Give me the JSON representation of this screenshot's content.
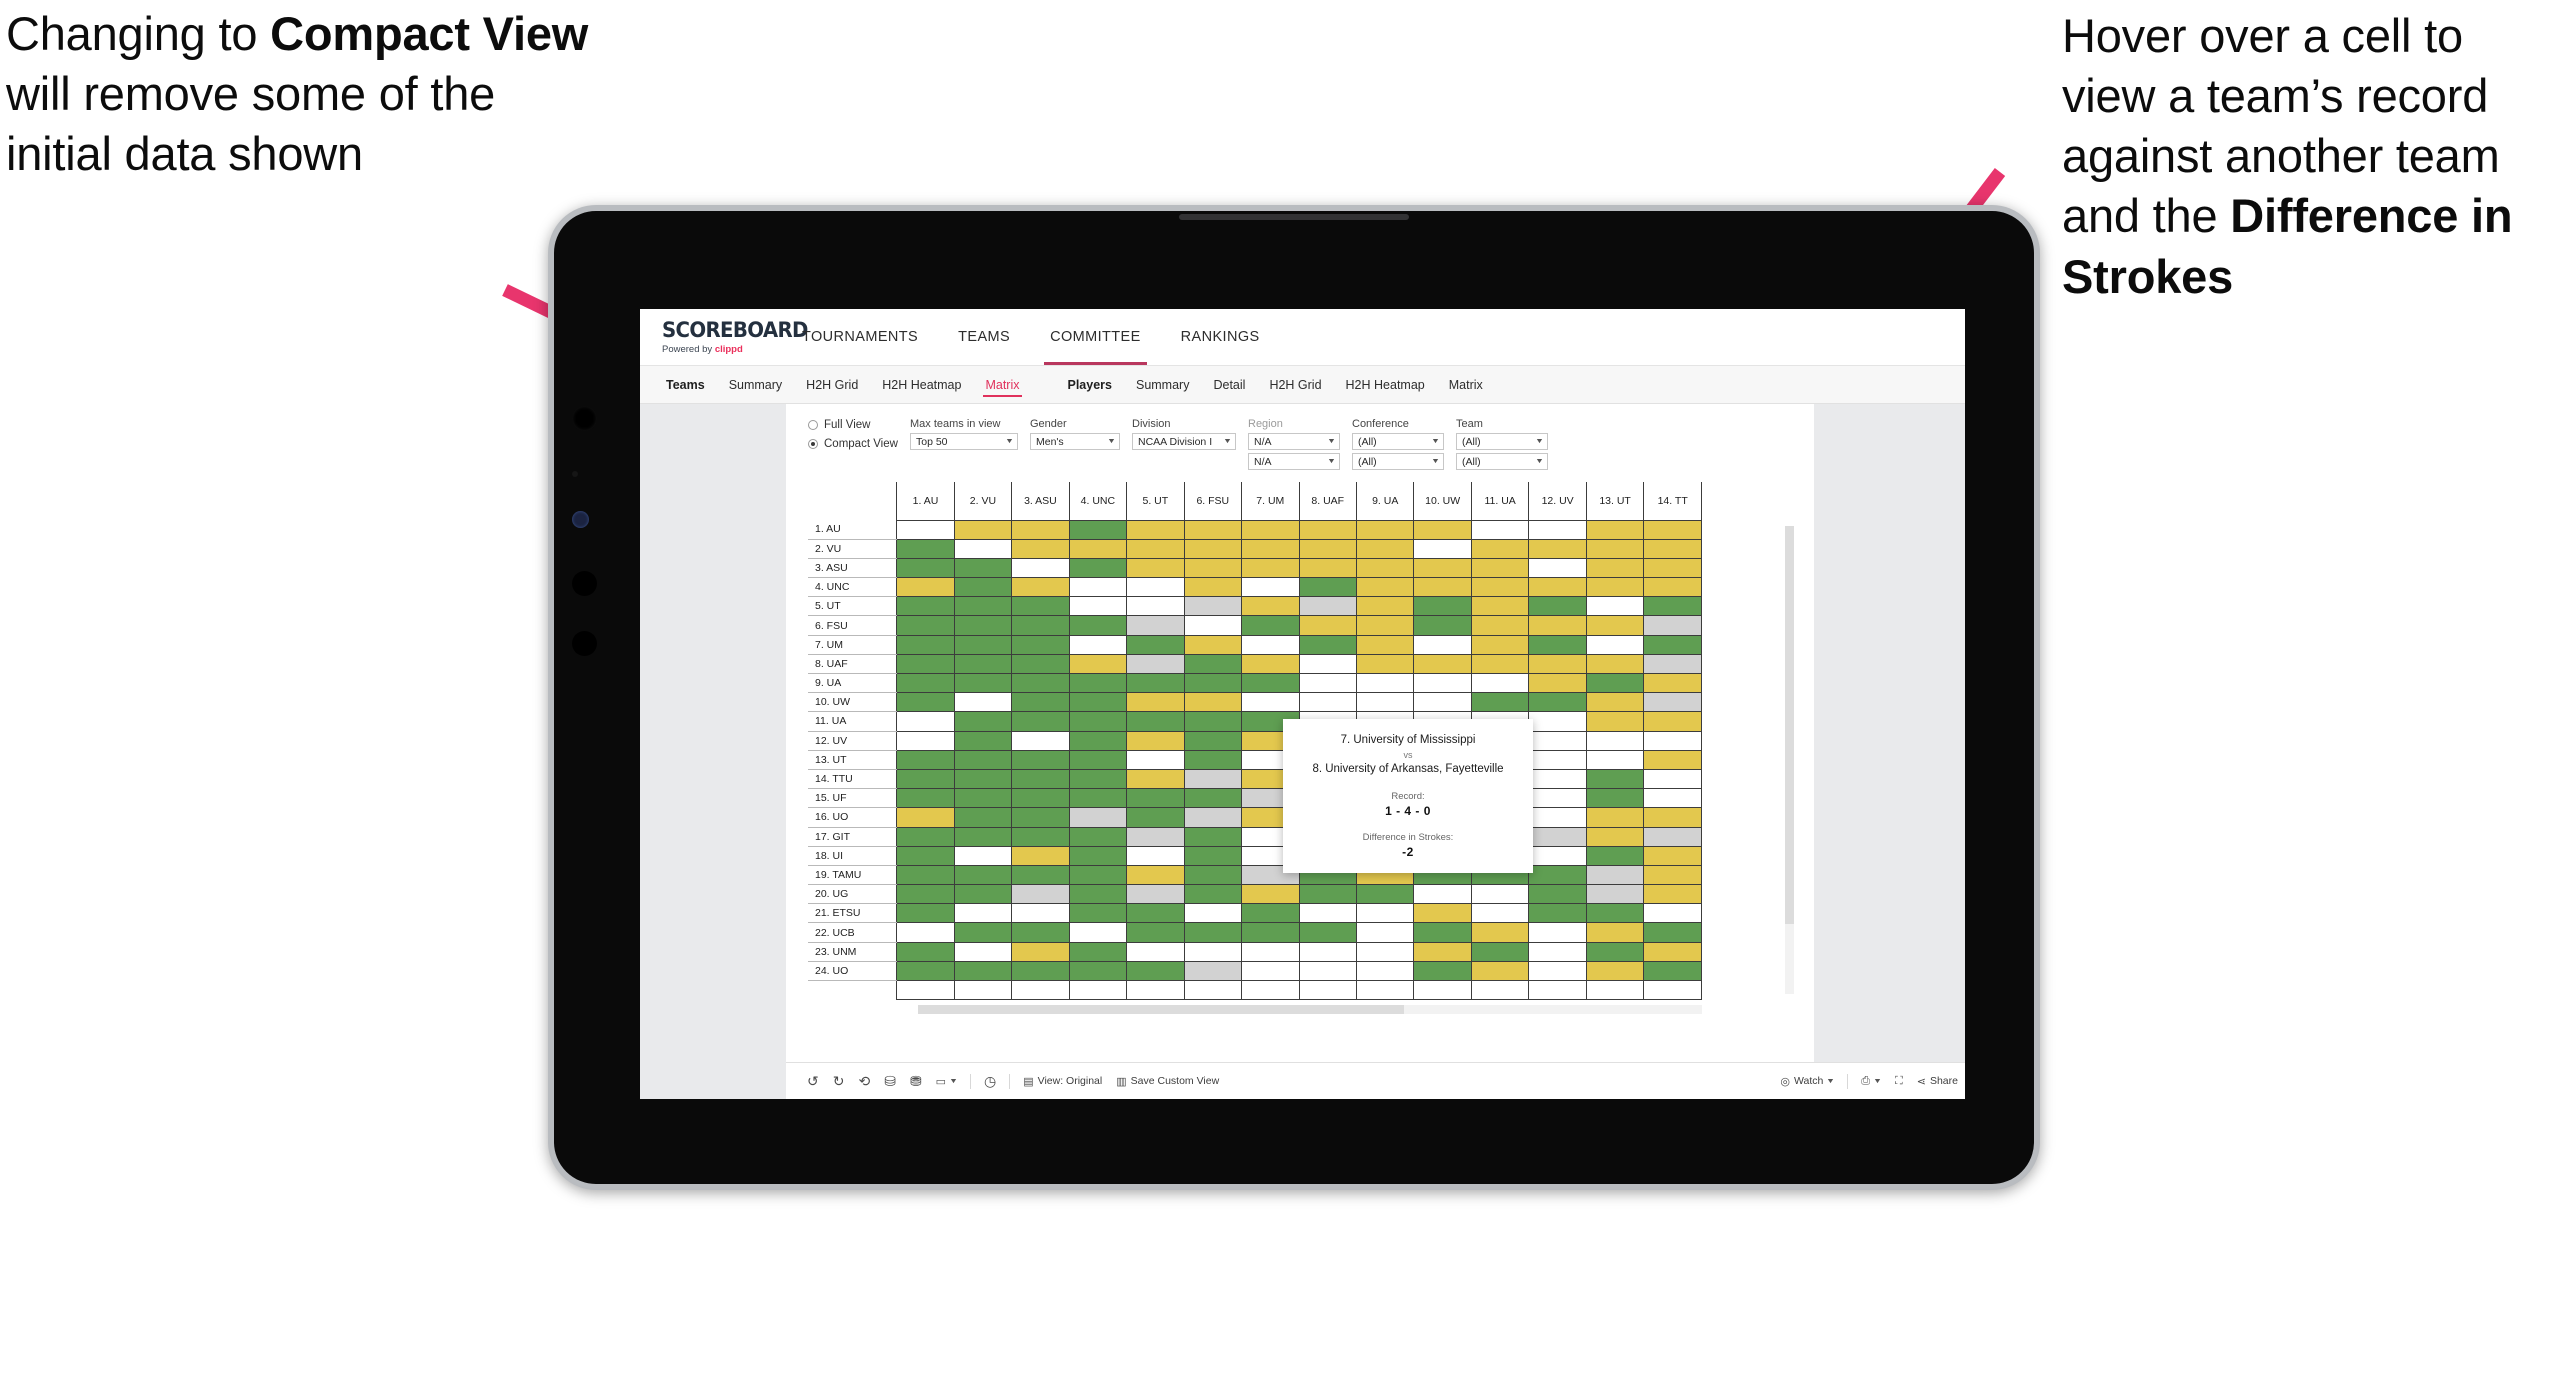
{
  "annotations": {
    "left": {
      "pre": "Changing to ",
      "bold": "Compact View",
      "post": " will remove some of the initial data shown"
    },
    "right": {
      "pre": "Hover over a cell to view a team’s record against another team and the ",
      "bold": "Difference in Strokes",
      "post": ""
    },
    "arrow_color": "#e8356d"
  },
  "app": {
    "brand": {
      "logo": "SCOREBOARD",
      "powered_prefix": "Powered by ",
      "powered_name": "clippd"
    },
    "topnav": [
      {
        "label": "TOURNAMENTS",
        "active": false
      },
      {
        "label": "TEAMS",
        "active": false
      },
      {
        "label": "COMMITTEE",
        "active": true
      },
      {
        "label": "RANKINGS",
        "active": false
      }
    ],
    "subnav": {
      "group1_title": "Teams",
      "group1": [
        {
          "label": "Summary",
          "active": false
        },
        {
          "label": "H2H Grid",
          "active": false
        },
        {
          "label": "H2H Heatmap",
          "active": false
        },
        {
          "label": "Matrix",
          "active": true
        }
      ],
      "group2_title": "Players",
      "group2": [
        {
          "label": "Summary",
          "active": false
        },
        {
          "label": "Detail",
          "active": false
        },
        {
          "label": "H2H Grid",
          "active": false
        },
        {
          "label": "H2H Heatmap",
          "active": false
        },
        {
          "label": "Matrix",
          "active": false
        }
      ]
    },
    "filters": {
      "view_modes": [
        {
          "label": "Full View",
          "selected": false
        },
        {
          "label": "Compact View",
          "selected": true
        }
      ],
      "fields": [
        {
          "label": "Max teams in view",
          "muted": false,
          "values": [
            "Top 50"
          ],
          "width": "w-teams"
        },
        {
          "label": "Gender",
          "muted": false,
          "values": [
            "Men's"
          ],
          "width": "w-gender"
        },
        {
          "label": "Division",
          "muted": false,
          "values": [
            "NCAA Division I"
          ],
          "width": "w-div"
        },
        {
          "label": "Region",
          "muted": true,
          "values": [
            "N/A",
            "N/A"
          ],
          "width": "w-reg"
        },
        {
          "label": "Conference",
          "muted": false,
          "values": [
            "(All)",
            "(All)"
          ],
          "width": "w-conf"
        },
        {
          "label": "Team",
          "muted": false,
          "values": [
            "(All)",
            "(All)"
          ],
          "width": "w-team"
        }
      ]
    },
    "tooltip": {
      "team_a": "7. University of Mississippi",
      "vs": "vs",
      "team_b": "8. University of Arkansas, Fayetteville",
      "record_label": "Record:",
      "record_value": "1 - 4 - 0",
      "strokes_label": "Difference in Strokes:",
      "strokes_value": "-2"
    },
    "toolbar": {
      "view_label": "View: Original",
      "save_label": "Save Custom View",
      "watch_label": "Watch",
      "share_label": "Share"
    }
  },
  "chart_data": {
    "type": "heatmap",
    "title": "Team Head-to-Head Matrix",
    "legend": {
      "win": "#5f9e52",
      "loss": "#e3c84e",
      "tie_or_na": "#d2d2d2",
      "none": "#ffffff"
    },
    "column_headers": [
      "1. AU",
      "2. VU",
      "3. ASU",
      "4. UNC",
      "5. UT",
      "6. FSU",
      "7. UM",
      "8. UAF",
      "9. UA",
      "10. UW",
      "11. UA",
      "12. UV",
      "13. UT",
      "14. TT"
    ],
    "row_headers": [
      "1. AU",
      "2. VU",
      "3. ASU",
      "4. UNC",
      "5. UT",
      "6. FSU",
      "7. UM",
      "8. UAF",
      "9. UA",
      "10. UW",
      "11. UA",
      "12. UV",
      "13. UT",
      "14. TTU",
      "15. UF",
      "16. UO",
      "17. GIT",
      "18. UI",
      "19. TAMU",
      "20. UG",
      "21. ETSU",
      "22. UCB",
      "23. UNM",
      "24. UO"
    ],
    "cells": [
      [
        "w",
        "y",
        "y",
        "g",
        "y",
        "y",
        "y",
        "y",
        "y",
        "y",
        "w",
        "w",
        "y",
        "y"
      ],
      [
        "g",
        "w",
        "y",
        "y",
        "y",
        "y",
        "y",
        "y",
        "y",
        "w",
        "y",
        "y",
        "y",
        "y"
      ],
      [
        "g",
        "g",
        "w",
        "g",
        "y",
        "y",
        "y",
        "y",
        "y",
        "y",
        "y",
        "w",
        "y",
        "y"
      ],
      [
        "y",
        "g",
        "y",
        "w",
        "w",
        "y",
        "w",
        "g",
        "y",
        "y",
        "y",
        "y",
        "y",
        "y"
      ],
      [
        "g",
        "g",
        "g",
        "w",
        "w",
        "a",
        "y",
        "a",
        "y",
        "g",
        "y",
        "g",
        "w",
        "g"
      ],
      [
        "g",
        "g",
        "g",
        "g",
        "a",
        "w",
        "g",
        "y",
        "y",
        "g",
        "y",
        "y",
        "y",
        "a"
      ],
      [
        "g",
        "g",
        "g",
        "w",
        "g",
        "y",
        "w",
        "g",
        "y",
        "w",
        "y",
        "g",
        "w",
        "g"
      ],
      [
        "g",
        "g",
        "g",
        "y",
        "a",
        "g",
        "y",
        "w",
        "y",
        "y",
        "y",
        "y",
        "y",
        "a"
      ],
      [
        "g",
        "g",
        "g",
        "g",
        "g",
        "g",
        "g",
        "w",
        "w",
        "w",
        "w",
        "y",
        "g",
        "y"
      ],
      [
        "g",
        "w",
        "g",
        "g",
        "y",
        "y",
        "w",
        "w",
        "w",
        "w",
        "g",
        "g",
        "y",
        "a"
      ],
      [
        "w",
        "g",
        "g",
        "g",
        "g",
        "g",
        "g",
        "w",
        "w",
        "w",
        "w",
        "w",
        "y",
        "y"
      ],
      [
        "w",
        "g",
        "w",
        "g",
        "y",
        "g",
        "y",
        "w",
        "w",
        "w",
        "w",
        "w",
        "w",
        "w"
      ],
      [
        "g",
        "g",
        "g",
        "g",
        "w",
        "g",
        "w",
        "w",
        "w",
        "w",
        "w",
        "w",
        "w",
        "y"
      ],
      [
        "g",
        "g",
        "g",
        "g",
        "y",
        "a",
        "y",
        "w",
        "w",
        "w",
        "w",
        "w",
        "g",
        "w"
      ],
      [
        "g",
        "g",
        "g",
        "g",
        "g",
        "g",
        "a",
        "w",
        "w",
        "w",
        "w",
        "w",
        "g",
        "w"
      ],
      [
        "y",
        "g",
        "g",
        "a",
        "g",
        "a",
        "y",
        "w",
        "w",
        "w",
        "g",
        "w",
        "y",
        "y"
      ],
      [
        "g",
        "g",
        "g",
        "g",
        "a",
        "g",
        "w",
        "w",
        "w",
        "w",
        "w",
        "a",
        "y",
        "a"
      ],
      [
        "g",
        "w",
        "y",
        "g",
        "w",
        "g",
        "w",
        "w",
        "w",
        "w",
        "w",
        "w",
        "g",
        "y"
      ],
      [
        "g",
        "g",
        "g",
        "g",
        "y",
        "g",
        "a",
        "g",
        "y",
        "g",
        "g",
        "g",
        "a",
        "y"
      ],
      [
        "g",
        "g",
        "a",
        "g",
        "a",
        "g",
        "y",
        "g",
        "g",
        "w",
        "w",
        "g",
        "a",
        "y"
      ],
      [
        "g",
        "w",
        "w",
        "g",
        "g",
        "w",
        "g",
        "w",
        "w",
        "y",
        "w",
        "g",
        "g",
        "w"
      ],
      [
        "w",
        "g",
        "g",
        "w",
        "g",
        "g",
        "g",
        "g",
        "w",
        "g",
        "y",
        "w",
        "y",
        "g"
      ],
      [
        "g",
        "w",
        "y",
        "g",
        "w",
        "w",
        "w",
        "w",
        "w",
        "y",
        "g",
        "w",
        "g",
        "y"
      ],
      [
        "g",
        "g",
        "g",
        "g",
        "g",
        "a",
        "w",
        "w",
        "w",
        "g",
        "y",
        "w",
        "y",
        "g"
      ]
    ]
  }
}
